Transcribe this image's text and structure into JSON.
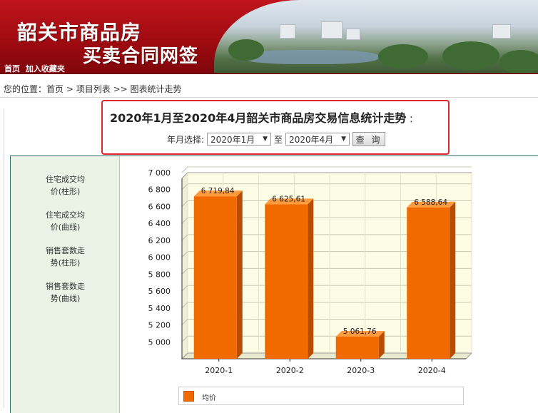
{
  "banner": {
    "title_line1": "韶关市商品房",
    "title_line2": "买卖合同网签",
    "links": [
      "首页",
      "加入收藏夹"
    ]
  },
  "breadcrumb": {
    "prefix": "您的位置：",
    "items": [
      "首页",
      "项目列表",
      "图表统计走势"
    ],
    "separator": ">"
  },
  "query": {
    "title": "2020年1月至2020年4月韶关市商品房交易信息统计走势",
    "title_suffix": "：",
    "label": "年月选择:",
    "start_value": "2020年1月",
    "to_label": "至",
    "end_value": "2020年4月",
    "button_label": "查 询"
  },
  "side_menu": {
    "items": [
      {
        "line1": "住宅成交均",
        "line2": "价(柱形)"
      },
      {
        "line1": "住宅成交均",
        "line2": "价(曲线)"
      },
      {
        "line1": "销售套数走",
        "line2": "势(柱形)"
      },
      {
        "line1": "销售套数走",
        "line2": "势(曲线)"
      }
    ]
  },
  "chart_data": {
    "type": "bar",
    "categories": [
      "2020-1",
      "2020-2",
      "2020-3",
      "2020-4"
    ],
    "series": [
      {
        "name": "均价",
        "values": [
          6719.84,
          6625.61,
          5061.76,
          6588.64
        ],
        "color": "#f06a00"
      }
    ],
    "data_labels": [
      "6 719,84",
      "6 625,61",
      "5 061,76",
      "6 588,64"
    ],
    "yticks": [
      "7 000",
      "6 800",
      "6 600",
      "6 400",
      "6 200",
      "6 000",
      "5 800",
      "5 600",
      "5 400",
      "5 200",
      "5 000"
    ],
    "ytick_values": [
      7000,
      6800,
      6600,
      6400,
      6200,
      6000,
      5800,
      5600,
      5400,
      5200,
      5000
    ],
    "ylim": [
      4800,
      7000
    ],
    "grid": true,
    "legend": "bottom"
  },
  "colors": {
    "brand_red": "#c0141b",
    "bar": "#f06a00",
    "plot_bg": "#fdfde6",
    "side_bg": "#eaf3e6"
  }
}
